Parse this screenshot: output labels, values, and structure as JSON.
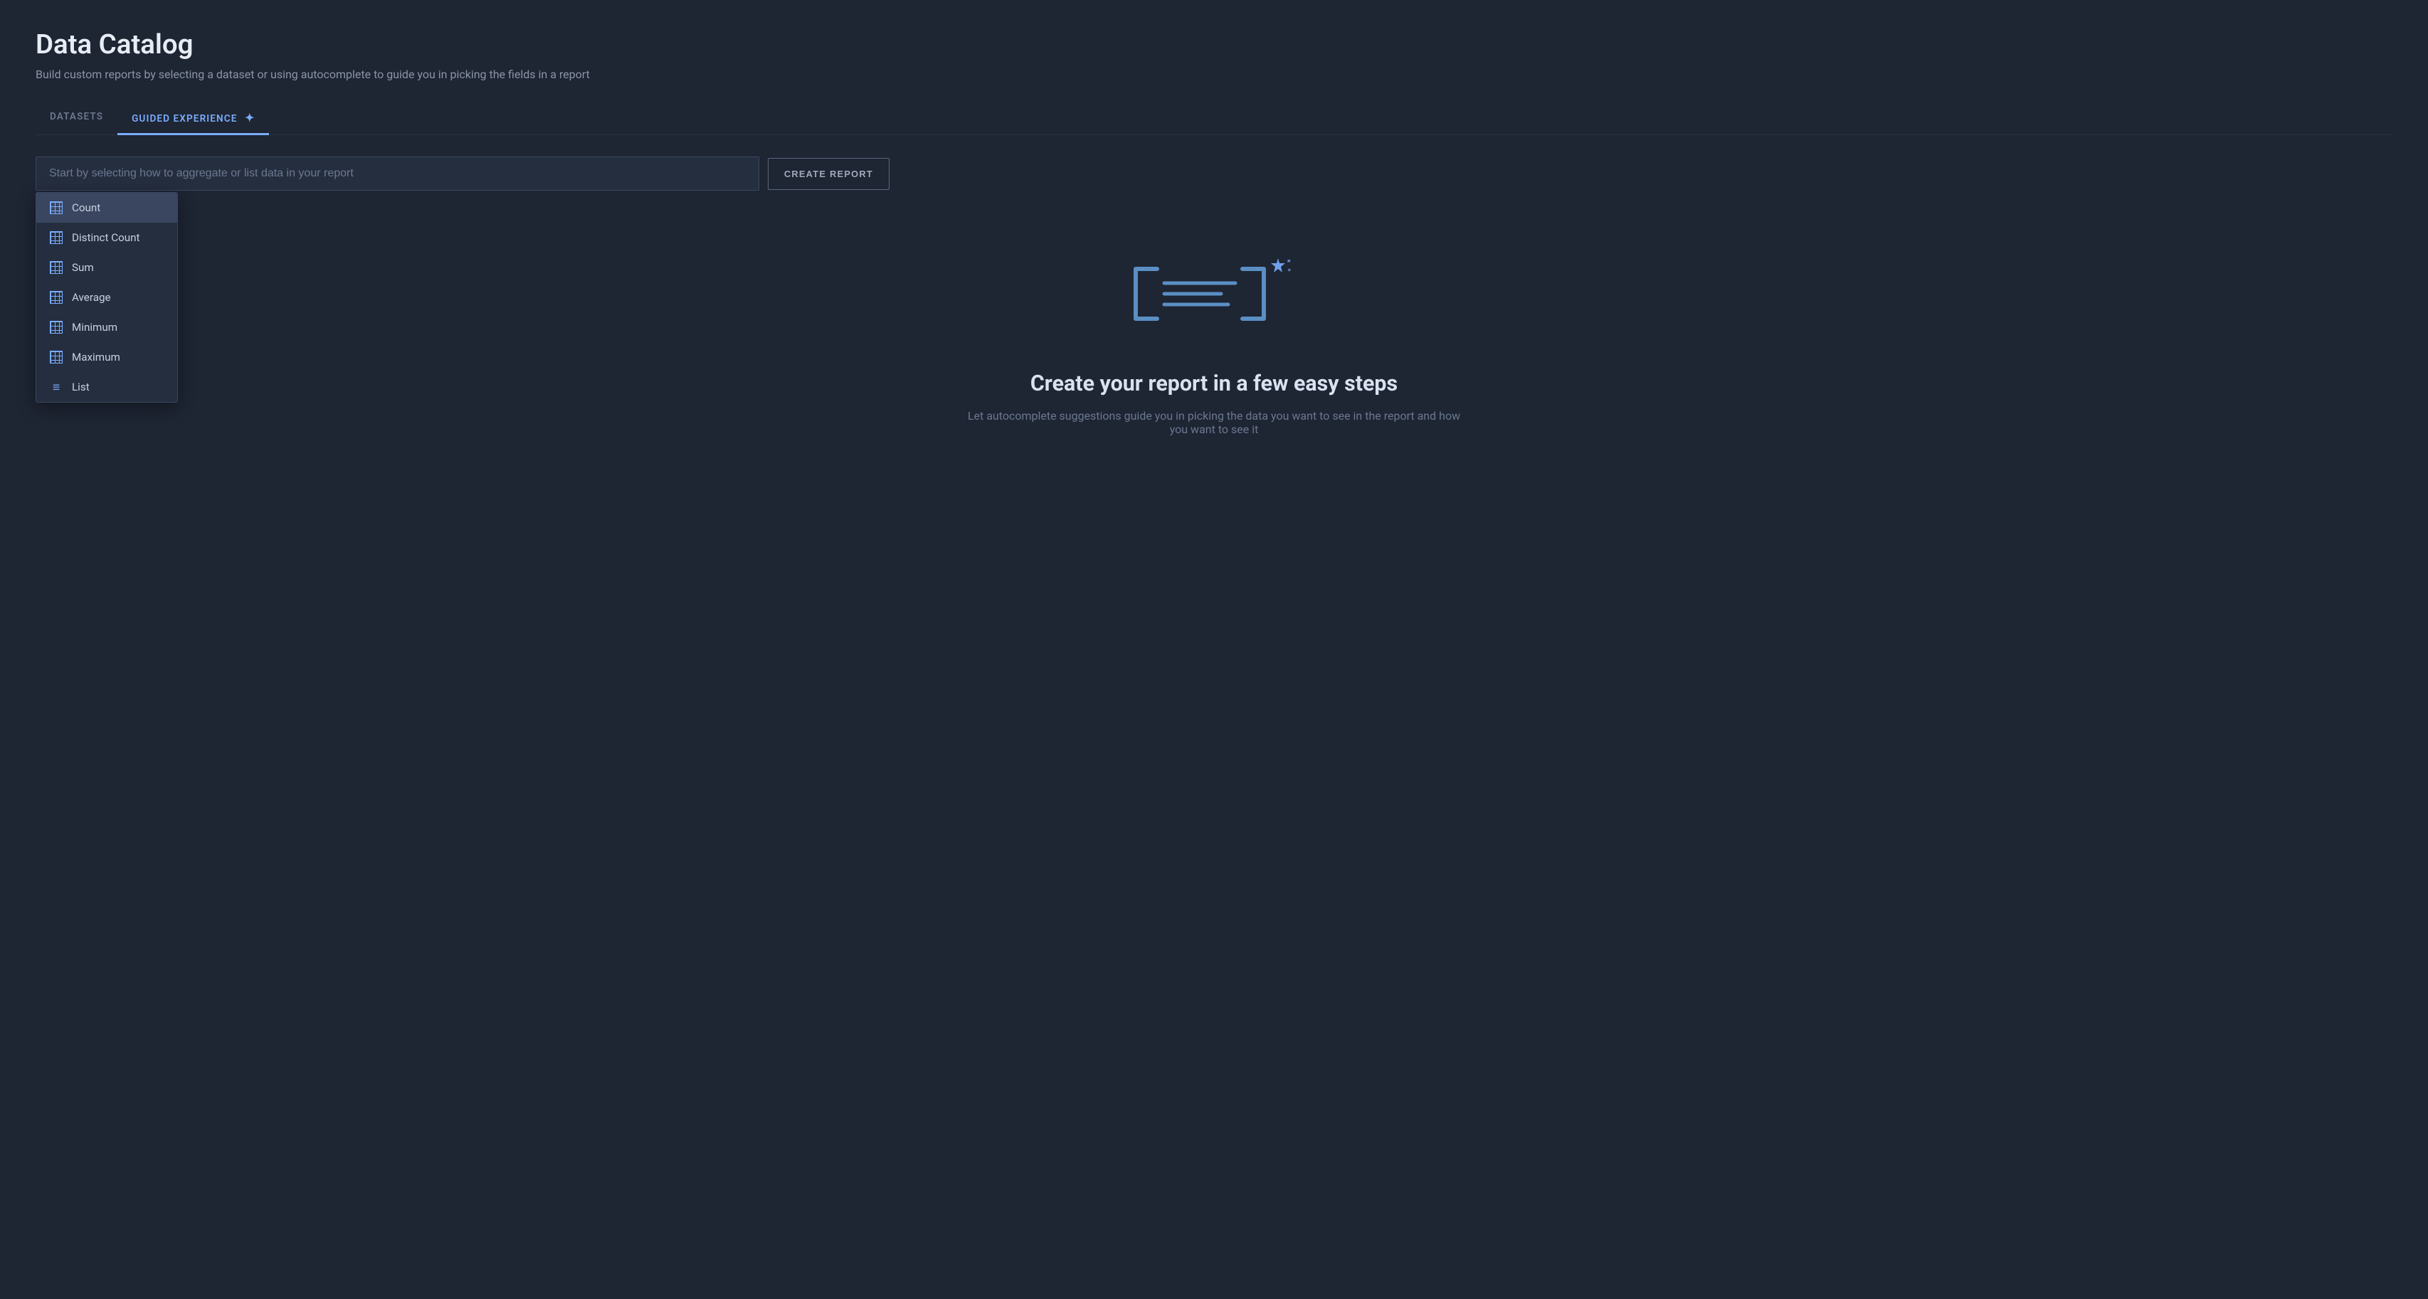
{
  "page": {
    "title": "Data Catalog",
    "subtitle": "Build custom reports by selecting a dataset or using autocomplete to guide you in picking the fields in a report"
  },
  "tabs": [
    {
      "id": "datasets",
      "label": "DATASETS",
      "active": false
    },
    {
      "id": "guided",
      "label": "GUIDED EXPERIENCE",
      "active": true,
      "icon": "✦"
    }
  ],
  "search": {
    "placeholder": "Start by selecting how to aggregate or list data in your report",
    "value": ""
  },
  "create_report_button": "CREATE REPORT",
  "dropdown": {
    "items": [
      {
        "id": "count",
        "label": "Count",
        "icon_type": "grid"
      },
      {
        "id": "distinct-count",
        "label": "Distinct Count",
        "icon_type": "grid"
      },
      {
        "id": "sum",
        "label": "Sum",
        "icon_type": "grid"
      },
      {
        "id": "average",
        "label": "Average",
        "icon_type": "grid"
      },
      {
        "id": "minimum",
        "label": "Minimum",
        "icon_type": "grid"
      },
      {
        "id": "maximum",
        "label": "Maximum",
        "icon_type": "grid"
      },
      {
        "id": "list",
        "label": "List",
        "icon_type": "list"
      }
    ]
  },
  "hero": {
    "title": "Create your report in a few easy steps",
    "description": "Let autocomplete suggestions guide you in picking the data you want to see in the report and how you want to see it"
  },
  "colors": {
    "accent": "#7aadff",
    "bg_primary": "#1e2533",
    "bg_secondary": "#252e3f",
    "bg_hover": "#3a4560",
    "text_primary": "#e8ecf4",
    "text_secondary": "#8a95a8",
    "border": "#3a4560"
  }
}
